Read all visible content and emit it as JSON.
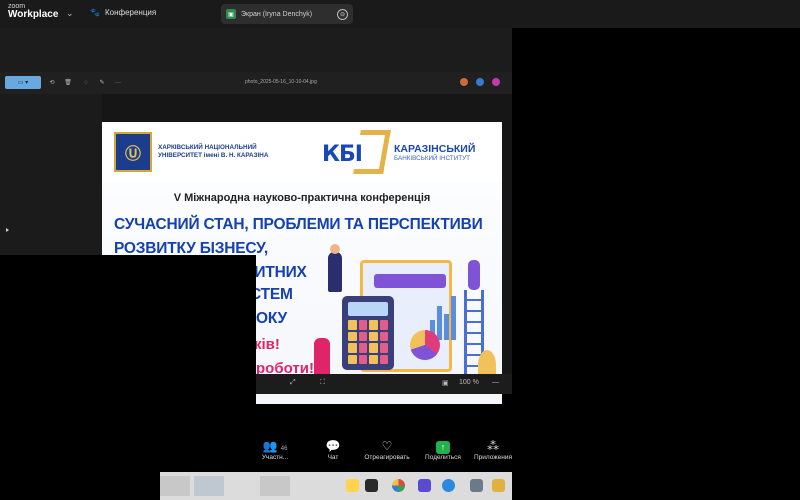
{
  "app": {
    "logo_line1": "zoom",
    "logo_line2": "Workplace",
    "conference_tab": "Конференция"
  },
  "share_banner": {
    "label": "Экран (Iryna Denchyk)"
  },
  "viewer": {
    "file_name": "photo_2025-05-16_10-10-04.jpg",
    "zoom_level": "100 %"
  },
  "slide": {
    "university_name": "ХАРКІВСЬКИЙ НАЦІОНАЛЬНИЙ УНІВЕРСИТЕТ імені В. Н. КАРАЗІНА",
    "kbi_abbrev": "КБІ",
    "kbi_name_line1": "КАРАЗІНСЬКИЙ",
    "kbi_name_line2": "БАНКІВСЬКИЙ ІНСТИТУТ",
    "conference": "V Міжнародна науково-практична конференція",
    "title_lines": [
      "СУЧАСНИЙ СТАН, ПРОБЛЕМИ ТА ПЕРСПЕКТИВИ",
      "РОЗВИТКУ БІЗНЕСУ,",
      "ФІНАНСОВО-КРЕДИТНИХ",
      "СТЕМ",
      "ОКУ"
    ],
    "greeting_lines": [
      "ків!",
      "роботи!"
    ]
  },
  "controls": {
    "participants_label": "Участн...",
    "participants_count": "46",
    "chat_label": "Чат",
    "reactions_label": "Отреагировать",
    "share_label": "Поделиться",
    "apps_label": "Приложения"
  },
  "colors": {
    "slide_blue": "#1541b0",
    "slide_pink": "#e0246a",
    "kbi_gold": "#e3b34a",
    "share_green": "#22b24c"
  }
}
